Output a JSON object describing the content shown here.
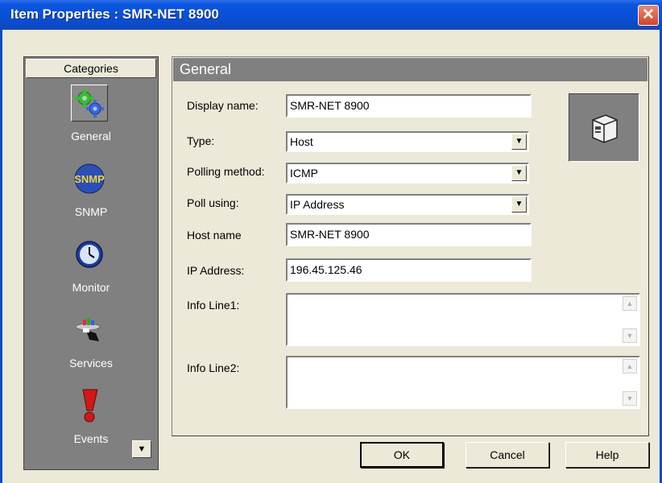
{
  "window": {
    "title": "Item Properties : SMR-NET 8900",
    "close_label": "✕"
  },
  "sidebar": {
    "header": "Categories",
    "items": [
      {
        "label": "General",
        "icon": "gears-icon",
        "selected": true
      },
      {
        "label": "SNMP",
        "icon": "snmp-icon"
      },
      {
        "label": "Monitor",
        "icon": "clock-icon"
      },
      {
        "label": "Services",
        "icon": "services-tray-icon"
      },
      {
        "label": "Events",
        "icon": "exclamation-icon"
      }
    ],
    "snmp_icon_text": "SNMP"
  },
  "section": {
    "title": "General"
  },
  "form": {
    "display_name_label": "Display name:",
    "display_name_value": "SMR-NET 8900",
    "type_label": "Type:",
    "type_value": "Host",
    "polling_method_label": "Polling method:",
    "polling_method_value": "ICMP",
    "poll_using_label": "Poll using:",
    "poll_using_value": "IP Address",
    "host_name_label": "Host name",
    "host_name_value": "SMR-NET 8900",
    "ip_address_label": "IP Address:",
    "ip_address_value": "196.45.125.46",
    "info_line1_label": "Info Line1:",
    "info_line1_value": "",
    "info_line2_label": "Info Line2:",
    "info_line2_value": ""
  },
  "buttons": {
    "ok": "OK",
    "cancel": "Cancel",
    "help": "Help"
  },
  "colors": {
    "titlebar": "#0a55de",
    "panel_gray": "#808080",
    "dialog_bg": "#ece9d8"
  }
}
